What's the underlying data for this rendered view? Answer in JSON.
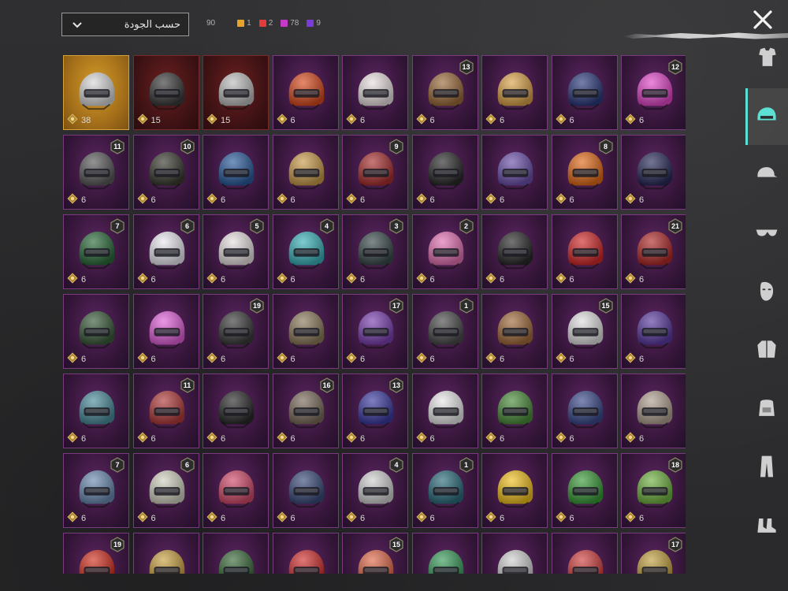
{
  "sort": {
    "selected": "حسب الجودة"
  },
  "counts": {
    "total": "90",
    "items": [
      {
        "value": "1",
        "color": "#e8a427"
      },
      {
        "value": "2",
        "color": "#e23b3b"
      },
      {
        "value": "78",
        "color": "#c33ac6"
      },
      {
        "value": "9",
        "color": "#7a3bd8"
      }
    ]
  },
  "sidebar": [
    {
      "name": "outfit-tab-icon",
      "active": false
    },
    {
      "name": "helmet-tab-icon",
      "active": true
    },
    {
      "name": "cap-tab-icon",
      "active": false
    },
    {
      "name": "glasses-tab-icon",
      "active": false
    },
    {
      "name": "mask-tab-icon",
      "active": false
    },
    {
      "name": "jacket-tab-icon",
      "active": false
    },
    {
      "name": "backpack-tab-icon",
      "active": false
    },
    {
      "name": "pants-tab-icon",
      "active": false
    },
    {
      "name": "shoes-tab-icon",
      "active": false
    }
  ],
  "items": [
    {
      "count": "38",
      "rarity": "gold",
      "level": "",
      "color": "#d8d8d8"
    },
    {
      "count": "15",
      "rarity": "red",
      "level": "",
      "color": "#3a3a3a"
    },
    {
      "count": "15",
      "rarity": "red",
      "level": "",
      "color": "#bdbdbd"
    },
    {
      "count": "6",
      "rarity": "purple",
      "level": "",
      "color": "#d64a1e"
    },
    {
      "count": "6",
      "rarity": "purple",
      "level": "",
      "color": "#e9e0e0"
    },
    {
      "count": "6",
      "rarity": "purple",
      "level": "13",
      "color": "#9a6a3a"
    },
    {
      "count": "6",
      "rarity": "purple",
      "level": "",
      "color": "#d9a24a"
    },
    {
      "count": "6",
      "rarity": "purple",
      "level": "",
      "color": "#2b3a7a"
    },
    {
      "count": "6",
      "rarity": "purple",
      "level": "12",
      "color": "#e048c8"
    },
    {
      "count": "6",
      "rarity": "purple",
      "level": "11",
      "color": "#5a5a5a"
    },
    {
      "count": "6",
      "rarity": "purple",
      "level": "10",
      "color": "#3a3a30"
    },
    {
      "count": "6",
      "rarity": "purple",
      "level": "",
      "color": "#2a5a9a"
    },
    {
      "count": "6",
      "rarity": "purple",
      "level": "",
      "color": "#c89a4a"
    },
    {
      "count": "6",
      "rarity": "purple",
      "level": "9",
      "color": "#a83030"
    },
    {
      "count": "6",
      "rarity": "purple",
      "level": "",
      "color": "#2a2a2a"
    },
    {
      "count": "6",
      "rarity": "purple",
      "level": "",
      "color": "#6a50a8"
    },
    {
      "count": "6",
      "rarity": "purple",
      "level": "8",
      "color": "#e06a1a"
    },
    {
      "count": "6",
      "rarity": "purple",
      "level": "",
      "color": "#2a2a5a"
    },
    {
      "count": "6",
      "rarity": "purple",
      "level": "7",
      "color": "#2a6a3a"
    },
    {
      "count": "6",
      "rarity": "purple",
      "level": "6",
      "color": "#e8e8f0"
    },
    {
      "count": "6",
      "rarity": "purple",
      "level": "5",
      "color": "#e8e0e0"
    },
    {
      "count": "6",
      "rarity": "purple",
      "level": "4",
      "color": "#3ab0b8"
    },
    {
      "count": "6",
      "rarity": "purple",
      "level": "3",
      "color": "#3a4a4a"
    },
    {
      "count": "6",
      "rarity": "purple",
      "level": "2",
      "color": "#e070b0"
    },
    {
      "count": "6",
      "rarity": "purple",
      "level": "",
      "color": "#2a2a2a"
    },
    {
      "count": "6",
      "rarity": "purple",
      "level": "",
      "color": "#d02a2a"
    },
    {
      "count": "6",
      "rarity": "purple",
      "level": "21",
      "color": "#b02a2a"
    },
    {
      "count": "6",
      "rarity": "purple",
      "level": "",
      "color": "#3a5a3a"
    },
    {
      "count": "6",
      "rarity": "purple",
      "level": "",
      "color": "#e060d8"
    },
    {
      "count": "6",
      "rarity": "purple",
      "level": "19",
      "color": "#3a3a3a"
    },
    {
      "count": "6",
      "rarity": "purple",
      "level": "",
      "color": "#8a7a5a"
    },
    {
      "count": "6",
      "rarity": "purple",
      "level": "17",
      "color": "#7a40b0"
    },
    {
      "count": "6",
      "rarity": "purple",
      "level": "1",
      "color": "#4a4a4a"
    },
    {
      "count": "6",
      "rarity": "purple",
      "level": "",
      "color": "#a06a3a"
    },
    {
      "count": "6",
      "rarity": "purple",
      "level": "15",
      "color": "#e0e0e0"
    },
    {
      "count": "6",
      "rarity": "purple",
      "level": "",
      "color": "#5a3aa0"
    },
    {
      "count": "6",
      "rarity": "purple",
      "level": "",
      "color": "#4a8a9a"
    },
    {
      "count": "6",
      "rarity": "purple",
      "level": "11",
      "color": "#b03a3a"
    },
    {
      "count": "6",
      "rarity": "purple",
      "level": "",
      "color": "#2a2a2a"
    },
    {
      "count": "6",
      "rarity": "purple",
      "level": "16",
      "color": "#7a6a5a"
    },
    {
      "count": "6",
      "rarity": "purple",
      "level": "13",
      "color": "#3a3aa0"
    },
    {
      "count": "6",
      "rarity": "purple",
      "level": "",
      "color": "#e8e8e8"
    },
    {
      "count": "6",
      "rarity": "purple",
      "level": "",
      "color": "#4a8a3a"
    },
    {
      "count": "6",
      "rarity": "purple",
      "level": "",
      "color": "#3a4a8a"
    },
    {
      "count": "6",
      "rarity": "purple",
      "level": "",
      "color": "#b0a090"
    },
    {
      "count": "6",
      "rarity": "purple",
      "level": "7",
      "color": "#6a8ab0"
    },
    {
      "count": "6",
      "rarity": "purple",
      "level": "6",
      "color": "#d0d0c0"
    },
    {
      "count": "6",
      "rarity": "purple",
      "level": "",
      "color": "#d04a6a"
    },
    {
      "count": "6",
      "rarity": "purple",
      "level": "",
      "color": "#3a4a7a"
    },
    {
      "count": "6",
      "rarity": "purple",
      "level": "4",
      "color": "#d0d0d0"
    },
    {
      "count": "6",
      "rarity": "purple",
      "level": "1",
      "color": "#2a6a7a"
    },
    {
      "count": "6",
      "rarity": "purple",
      "level": "",
      "color": "#f0c020"
    },
    {
      "count": "6",
      "rarity": "purple",
      "level": "",
      "color": "#3a9a3a"
    },
    {
      "count": "6",
      "rarity": "purple",
      "level": "18",
      "color": "#70b040"
    },
    {
      "count": "",
      "rarity": "purple",
      "level": "19",
      "color": "#d03020"
    },
    {
      "count": "",
      "rarity": "purple",
      "level": "",
      "color": "#c8a040"
    },
    {
      "count": "",
      "rarity": "purple",
      "level": "",
      "color": "#3a6a3a"
    },
    {
      "count": "",
      "rarity": "purple",
      "level": "",
      "color": "#d03030"
    },
    {
      "count": "",
      "rarity": "purple",
      "level": "15",
      "color": "#e06a4a"
    },
    {
      "count": "",
      "rarity": "purple",
      "level": "",
      "color": "#3a9a5a"
    },
    {
      "count": "",
      "rarity": "purple",
      "level": "",
      "color": "#d0d0d0"
    },
    {
      "count": "",
      "rarity": "purple",
      "level": "",
      "color": "#d04040"
    },
    {
      "count": "",
      "rarity": "purple",
      "level": "17",
      "color": "#c0a040"
    }
  ]
}
